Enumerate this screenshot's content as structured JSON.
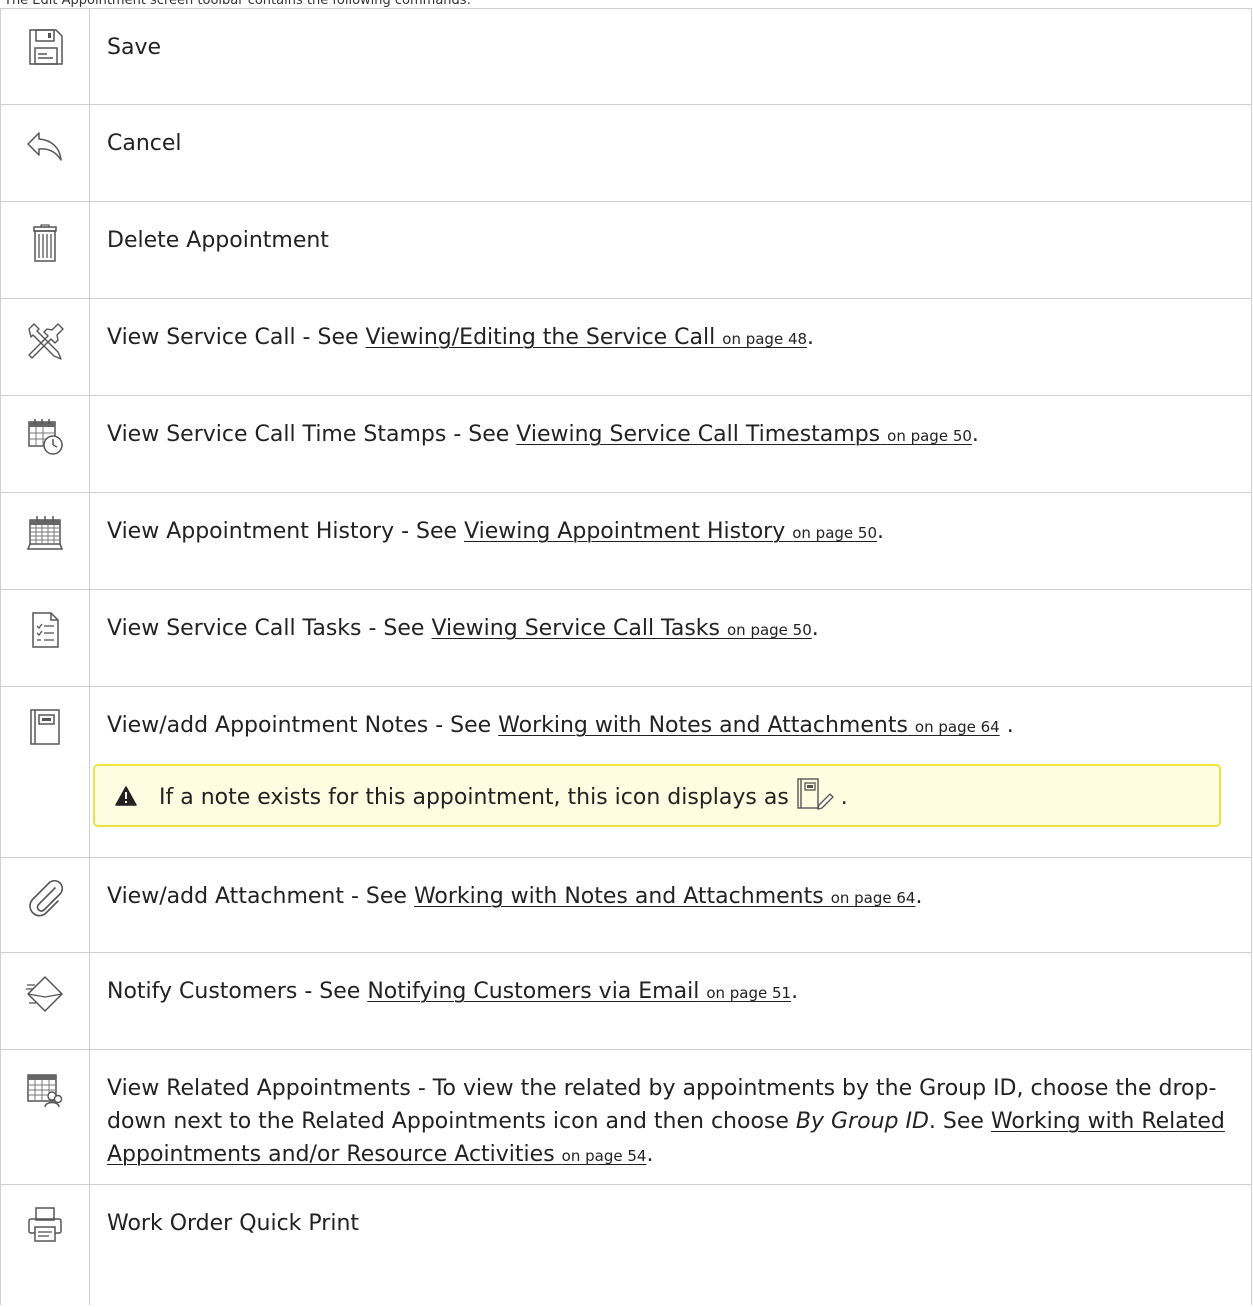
{
  "top_fragment": "The Edit Appointment screen toolbar contains the following commands:",
  "rows": [
    {
      "icon": "floppy-disk-icon",
      "label": "Save"
    },
    {
      "icon": "undo-arrow-icon",
      "label": "Cancel"
    },
    {
      "icon": "trash-can-icon",
      "label": "Delete Appointment"
    },
    {
      "icon": "tools-icon",
      "label": "View Service Call - See ",
      "link": "Viewing/Editing the Service Call",
      "page": "on page 48",
      "after": "."
    },
    {
      "icon": "calendar-clock-icon",
      "label": "View Service Call Time Stamps - See ",
      "link": "Viewing Service Call Timestamps",
      "page": "on page 50",
      "after": "."
    },
    {
      "icon": "calendar-history-icon",
      "label": "View Appointment History - See ",
      "link": "Viewing Appointment History",
      "page": "on page 50",
      "after": "."
    },
    {
      "icon": "task-list-icon",
      "label": "View Service Call Tasks - See ",
      "link": "Viewing Service Call Tasks",
      "page": "on page 50",
      "after": "."
    },
    {
      "icon": "notebook-icon",
      "label": "View/add Appointment Notes - See ",
      "link": "Working with Notes and Attachments",
      "page": "on page 64",
      "after": " .",
      "note": {
        "icon": "warning-icon",
        "text": "If a note exists for this appointment, this icon displays as",
        "inline_icon": "notebook-pencil-icon",
        "after": "."
      }
    },
    {
      "icon": "paperclip-icon",
      "label": "View/add Attachment - See ",
      "link": "Working with Notes and Attachments",
      "page": "on page 64",
      "after": "."
    },
    {
      "icon": "envelope-icon",
      "label": "Notify Customers - See ",
      "link": "Notifying Customers via Email",
      "page": "on page 51",
      "after": "."
    },
    {
      "icon": "calendar-people-icon",
      "label": "View Related Appointments - To view the related by appointments by the Group ID, choose the drop-down next to the Related Appointments icon and then choose ",
      "emph": "By Group ID",
      "label2": ". See ",
      "link": "Working with Related Appointments and/or Resource Activities",
      "page": "on page 54",
      "after": "."
    },
    {
      "icon": "printer-icon",
      "label": "Work Order Quick Print"
    }
  ]
}
